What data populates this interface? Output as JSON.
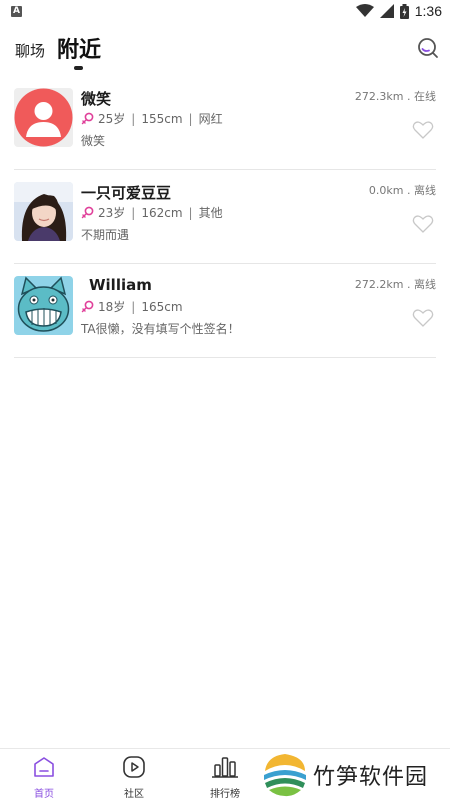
{
  "status_bar": {
    "time": "1:36",
    "left_badge": "A"
  },
  "header": {
    "tab_chat": "聊场",
    "tab_nearby": "附近"
  },
  "users": [
    {
      "name": "微笑",
      "age": "25岁",
      "height": "155cm",
      "tag": "网红",
      "signature": "微笑",
      "distance": "272.3km . 在线",
      "avatar": "default-avatar"
    },
    {
      "name": "一只可爱豆豆",
      "age": "23岁",
      "height": "162cm",
      "tag": "其他",
      "signature": "不期而遇",
      "distance": "0.0km . 离线",
      "avatar": "photo-girl"
    },
    {
      "name": "William",
      "age": "18岁",
      "height": "165cm",
      "signature": "TA很懒，没有填写个性签名！",
      "distance": "272.2km . 离线",
      "avatar": "cartoon-cat"
    }
  ],
  "bottom_nav": {
    "home": "首页",
    "community": "社区",
    "ranking": "排行榜"
  },
  "watermark": "竹笋软件园",
  "colors": {
    "accent": "#8a4fe0",
    "female_icon": "#e0409a",
    "avatar_default_bg": "#f05a5a"
  }
}
